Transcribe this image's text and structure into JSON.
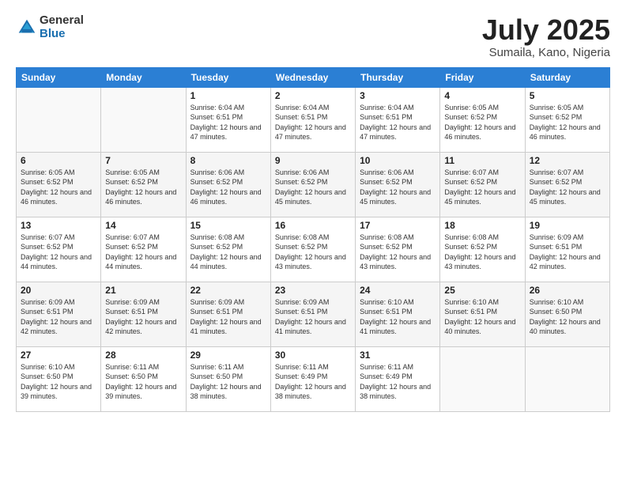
{
  "logo": {
    "general": "General",
    "blue": "Blue"
  },
  "title": {
    "month": "July 2025",
    "location": "Sumaila, Kano, Nigeria"
  },
  "weekdays": [
    "Sunday",
    "Monday",
    "Tuesday",
    "Wednesday",
    "Thursday",
    "Friday",
    "Saturday"
  ],
  "weeks": [
    [
      {
        "day": "",
        "empty": true
      },
      {
        "day": "",
        "empty": true
      },
      {
        "day": "1",
        "sunrise": "6:04 AM",
        "sunset": "6:51 PM",
        "daylight": "12 hours and 47 minutes."
      },
      {
        "day": "2",
        "sunrise": "6:04 AM",
        "sunset": "6:51 PM",
        "daylight": "12 hours and 47 minutes."
      },
      {
        "day": "3",
        "sunrise": "6:04 AM",
        "sunset": "6:51 PM",
        "daylight": "12 hours and 47 minutes."
      },
      {
        "day": "4",
        "sunrise": "6:05 AM",
        "sunset": "6:52 PM",
        "daylight": "12 hours and 46 minutes."
      },
      {
        "day": "5",
        "sunrise": "6:05 AM",
        "sunset": "6:52 PM",
        "daylight": "12 hours and 46 minutes."
      }
    ],
    [
      {
        "day": "6",
        "sunrise": "6:05 AM",
        "sunset": "6:52 PM",
        "daylight": "12 hours and 46 minutes."
      },
      {
        "day": "7",
        "sunrise": "6:05 AM",
        "sunset": "6:52 PM",
        "daylight": "12 hours and 46 minutes."
      },
      {
        "day": "8",
        "sunrise": "6:06 AM",
        "sunset": "6:52 PM",
        "daylight": "12 hours and 46 minutes."
      },
      {
        "day": "9",
        "sunrise": "6:06 AM",
        "sunset": "6:52 PM",
        "daylight": "12 hours and 45 minutes."
      },
      {
        "day": "10",
        "sunrise": "6:06 AM",
        "sunset": "6:52 PM",
        "daylight": "12 hours and 45 minutes."
      },
      {
        "day": "11",
        "sunrise": "6:07 AM",
        "sunset": "6:52 PM",
        "daylight": "12 hours and 45 minutes."
      },
      {
        "day": "12",
        "sunrise": "6:07 AM",
        "sunset": "6:52 PM",
        "daylight": "12 hours and 45 minutes."
      }
    ],
    [
      {
        "day": "13",
        "sunrise": "6:07 AM",
        "sunset": "6:52 PM",
        "daylight": "12 hours and 44 minutes."
      },
      {
        "day": "14",
        "sunrise": "6:07 AM",
        "sunset": "6:52 PM",
        "daylight": "12 hours and 44 minutes."
      },
      {
        "day": "15",
        "sunrise": "6:08 AM",
        "sunset": "6:52 PM",
        "daylight": "12 hours and 44 minutes."
      },
      {
        "day": "16",
        "sunrise": "6:08 AM",
        "sunset": "6:52 PM",
        "daylight": "12 hours and 43 minutes."
      },
      {
        "day": "17",
        "sunrise": "6:08 AM",
        "sunset": "6:52 PM",
        "daylight": "12 hours and 43 minutes."
      },
      {
        "day": "18",
        "sunrise": "6:08 AM",
        "sunset": "6:52 PM",
        "daylight": "12 hours and 43 minutes."
      },
      {
        "day": "19",
        "sunrise": "6:09 AM",
        "sunset": "6:51 PM",
        "daylight": "12 hours and 42 minutes."
      }
    ],
    [
      {
        "day": "20",
        "sunrise": "6:09 AM",
        "sunset": "6:51 PM",
        "daylight": "12 hours and 42 minutes."
      },
      {
        "day": "21",
        "sunrise": "6:09 AM",
        "sunset": "6:51 PM",
        "daylight": "12 hours and 42 minutes."
      },
      {
        "day": "22",
        "sunrise": "6:09 AM",
        "sunset": "6:51 PM",
        "daylight": "12 hours and 41 minutes."
      },
      {
        "day": "23",
        "sunrise": "6:09 AM",
        "sunset": "6:51 PM",
        "daylight": "12 hours and 41 minutes."
      },
      {
        "day": "24",
        "sunrise": "6:10 AM",
        "sunset": "6:51 PM",
        "daylight": "12 hours and 41 minutes."
      },
      {
        "day": "25",
        "sunrise": "6:10 AM",
        "sunset": "6:51 PM",
        "daylight": "12 hours and 40 minutes."
      },
      {
        "day": "26",
        "sunrise": "6:10 AM",
        "sunset": "6:50 PM",
        "daylight": "12 hours and 40 minutes."
      }
    ],
    [
      {
        "day": "27",
        "sunrise": "6:10 AM",
        "sunset": "6:50 PM",
        "daylight": "12 hours and 39 minutes."
      },
      {
        "day": "28",
        "sunrise": "6:11 AM",
        "sunset": "6:50 PM",
        "daylight": "12 hours and 39 minutes."
      },
      {
        "day": "29",
        "sunrise": "6:11 AM",
        "sunset": "6:50 PM",
        "daylight": "12 hours and 38 minutes."
      },
      {
        "day": "30",
        "sunrise": "6:11 AM",
        "sunset": "6:49 PM",
        "daylight": "12 hours and 38 minutes."
      },
      {
        "day": "31",
        "sunrise": "6:11 AM",
        "sunset": "6:49 PM",
        "daylight": "12 hours and 38 minutes."
      },
      {
        "day": "",
        "empty": true
      },
      {
        "day": "",
        "empty": true
      }
    ]
  ]
}
